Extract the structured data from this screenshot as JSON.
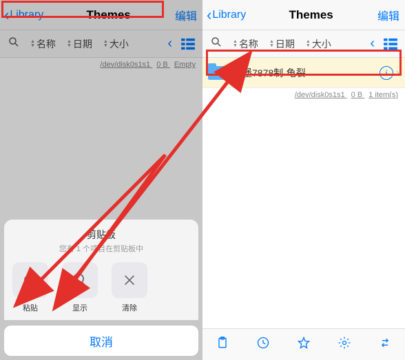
{
  "left": {
    "back_label": "Library",
    "title": "Themes",
    "edit": "编辑",
    "sort": {
      "name": "名称",
      "date": "日期",
      "size": "大小"
    },
    "status": {
      "path": "/dev/disk0s1s1",
      "size": "0 B",
      "summary": "Empty"
    },
    "sheet": {
      "title": "剪贴板",
      "subtitle": "您有 1 个项目在剪贴板中",
      "paste": "粘贴",
      "show": "显示",
      "clear": "清除",
      "cancel": "取消"
    }
  },
  "right": {
    "back_label": "Library",
    "title": "Themes",
    "edit": "编辑",
    "sort": {
      "name": "名称",
      "date": "日期",
      "size": "大小"
    },
    "folder": {
      "name": "汉堡7878制-龟裂"
    },
    "status": {
      "path": "/dev/disk0s1s1",
      "size": "0 B",
      "summary": "1 item(s)"
    }
  }
}
